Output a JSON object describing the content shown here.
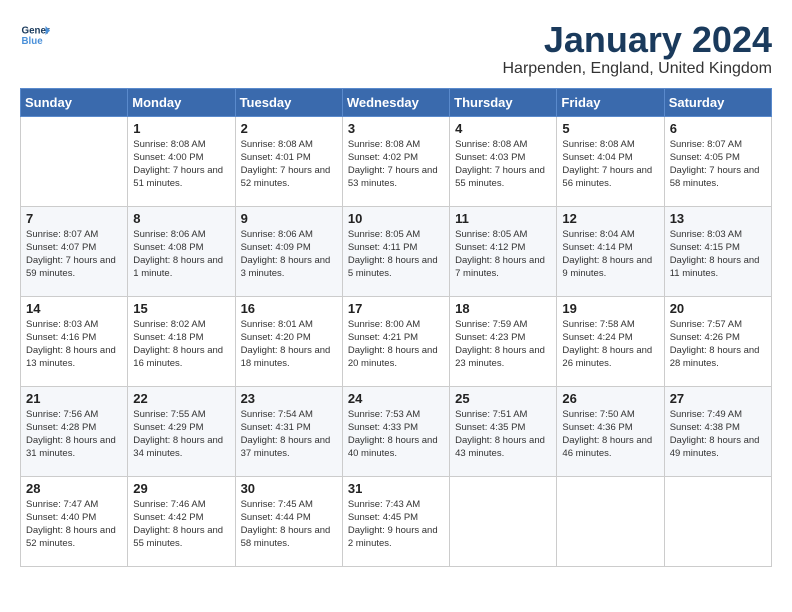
{
  "header": {
    "logo_line1": "General",
    "logo_line2": "Blue",
    "month": "January 2024",
    "location": "Harpenden, England, United Kingdom"
  },
  "days_of_week": [
    "Sunday",
    "Monday",
    "Tuesday",
    "Wednesday",
    "Thursday",
    "Friday",
    "Saturday"
  ],
  "weeks": [
    [
      {
        "num": "",
        "sunrise": "",
        "sunset": "",
        "daylight": ""
      },
      {
        "num": "1",
        "sunrise": "8:08 AM",
        "sunset": "4:00 PM",
        "daylight": "7 hours and 51 minutes."
      },
      {
        "num": "2",
        "sunrise": "8:08 AM",
        "sunset": "4:01 PM",
        "daylight": "7 hours and 52 minutes."
      },
      {
        "num": "3",
        "sunrise": "8:08 AM",
        "sunset": "4:02 PM",
        "daylight": "7 hours and 53 minutes."
      },
      {
        "num": "4",
        "sunrise": "8:08 AM",
        "sunset": "4:03 PM",
        "daylight": "7 hours and 55 minutes."
      },
      {
        "num": "5",
        "sunrise": "8:08 AM",
        "sunset": "4:04 PM",
        "daylight": "7 hours and 56 minutes."
      },
      {
        "num": "6",
        "sunrise": "8:07 AM",
        "sunset": "4:05 PM",
        "daylight": "7 hours and 58 minutes."
      }
    ],
    [
      {
        "num": "7",
        "sunrise": "8:07 AM",
        "sunset": "4:07 PM",
        "daylight": "7 hours and 59 minutes."
      },
      {
        "num": "8",
        "sunrise": "8:06 AM",
        "sunset": "4:08 PM",
        "daylight": "8 hours and 1 minute."
      },
      {
        "num": "9",
        "sunrise": "8:06 AM",
        "sunset": "4:09 PM",
        "daylight": "8 hours and 3 minutes."
      },
      {
        "num": "10",
        "sunrise": "8:05 AM",
        "sunset": "4:11 PM",
        "daylight": "8 hours and 5 minutes."
      },
      {
        "num": "11",
        "sunrise": "8:05 AM",
        "sunset": "4:12 PM",
        "daylight": "8 hours and 7 minutes."
      },
      {
        "num": "12",
        "sunrise": "8:04 AM",
        "sunset": "4:14 PM",
        "daylight": "8 hours and 9 minutes."
      },
      {
        "num": "13",
        "sunrise": "8:03 AM",
        "sunset": "4:15 PM",
        "daylight": "8 hours and 11 minutes."
      }
    ],
    [
      {
        "num": "14",
        "sunrise": "8:03 AM",
        "sunset": "4:16 PM",
        "daylight": "8 hours and 13 minutes."
      },
      {
        "num": "15",
        "sunrise": "8:02 AM",
        "sunset": "4:18 PM",
        "daylight": "8 hours and 16 minutes."
      },
      {
        "num": "16",
        "sunrise": "8:01 AM",
        "sunset": "4:20 PM",
        "daylight": "8 hours and 18 minutes."
      },
      {
        "num": "17",
        "sunrise": "8:00 AM",
        "sunset": "4:21 PM",
        "daylight": "8 hours and 20 minutes."
      },
      {
        "num": "18",
        "sunrise": "7:59 AM",
        "sunset": "4:23 PM",
        "daylight": "8 hours and 23 minutes."
      },
      {
        "num": "19",
        "sunrise": "7:58 AM",
        "sunset": "4:24 PM",
        "daylight": "8 hours and 26 minutes."
      },
      {
        "num": "20",
        "sunrise": "7:57 AM",
        "sunset": "4:26 PM",
        "daylight": "8 hours and 28 minutes."
      }
    ],
    [
      {
        "num": "21",
        "sunrise": "7:56 AM",
        "sunset": "4:28 PM",
        "daylight": "8 hours and 31 minutes."
      },
      {
        "num": "22",
        "sunrise": "7:55 AM",
        "sunset": "4:29 PM",
        "daylight": "8 hours and 34 minutes."
      },
      {
        "num": "23",
        "sunrise": "7:54 AM",
        "sunset": "4:31 PM",
        "daylight": "8 hours and 37 minutes."
      },
      {
        "num": "24",
        "sunrise": "7:53 AM",
        "sunset": "4:33 PM",
        "daylight": "8 hours and 40 minutes."
      },
      {
        "num": "25",
        "sunrise": "7:51 AM",
        "sunset": "4:35 PM",
        "daylight": "8 hours and 43 minutes."
      },
      {
        "num": "26",
        "sunrise": "7:50 AM",
        "sunset": "4:36 PM",
        "daylight": "8 hours and 46 minutes."
      },
      {
        "num": "27",
        "sunrise": "7:49 AM",
        "sunset": "4:38 PM",
        "daylight": "8 hours and 49 minutes."
      }
    ],
    [
      {
        "num": "28",
        "sunrise": "7:47 AM",
        "sunset": "4:40 PM",
        "daylight": "8 hours and 52 minutes."
      },
      {
        "num": "29",
        "sunrise": "7:46 AM",
        "sunset": "4:42 PM",
        "daylight": "8 hours and 55 minutes."
      },
      {
        "num": "30",
        "sunrise": "7:45 AM",
        "sunset": "4:44 PM",
        "daylight": "8 hours and 58 minutes."
      },
      {
        "num": "31",
        "sunrise": "7:43 AM",
        "sunset": "4:45 PM",
        "daylight": "9 hours and 2 minutes."
      },
      {
        "num": "",
        "sunrise": "",
        "sunset": "",
        "daylight": ""
      },
      {
        "num": "",
        "sunrise": "",
        "sunset": "",
        "daylight": ""
      },
      {
        "num": "",
        "sunrise": "",
        "sunset": "",
        "daylight": ""
      }
    ]
  ]
}
